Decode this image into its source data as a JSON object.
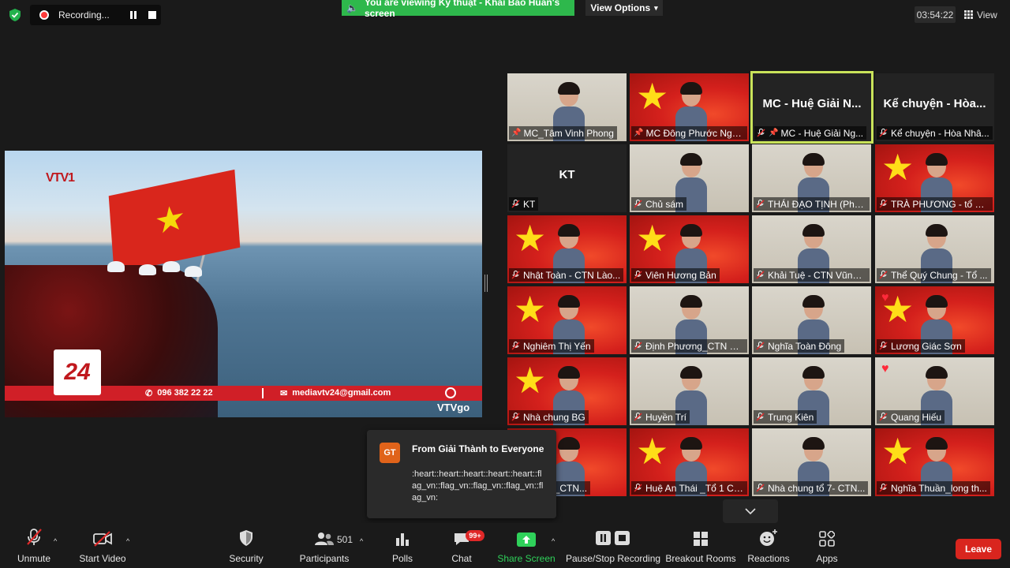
{
  "top": {
    "recording_label": "Recording...",
    "viewing_banner": "You are viewing Kỹ thuật - Khải Bảo Huấn's screen",
    "view_options": "View Options",
    "timer": "03:54:22",
    "view_label": "View"
  },
  "shared_screen": {
    "channel_logo": "VTV1",
    "badge": "24",
    "ticker_phone": "096 382 22 22",
    "ticker_email": "mediavtv24@gmail.com",
    "corner_logo": "VTVgo"
  },
  "participants": [
    {
      "name": "MC_Tâm Vinh Phong",
      "center_name": "",
      "muted": false,
      "pinned": true
    },
    {
      "name": "MC Đông Phước Nghĩa",
      "center_name": "",
      "muted": false,
      "pinned": true
    },
    {
      "name": "MC - Huệ Giải Ng...",
      "center_name": "MC - Huệ Giải N...",
      "muted": true,
      "pinned": true,
      "active_speaker": true
    },
    {
      "name": "Kể chuyện - Hòa Nhâ...",
      "center_name": "Kể chuyện - Hòa...",
      "muted": true,
      "pinned": false
    },
    {
      "name": "KT",
      "center_name": "KT",
      "muted": true,
      "pinned": false
    },
    {
      "name": "Chủ sám",
      "center_name": "",
      "muted": true,
      "pinned": false
    },
    {
      "name": "THÁI ĐẠO TỊNH (Phật...",
      "center_name": "",
      "muted": true,
      "pinned": false
    },
    {
      "name": "TRÀ PHƯƠNG - tổ 1 ...",
      "center_name": "",
      "muted": true,
      "pinned": false
    },
    {
      "name": "Nhật Toàn - CTN Lào...",
      "center_name": "",
      "muted": true,
      "pinned": false
    },
    {
      "name": "Viên Hương Bản",
      "center_name": "",
      "muted": true,
      "pinned": false
    },
    {
      "name": "Khải Tuệ - CTN Vũng ...",
      "center_name": "",
      "muted": true,
      "pinned": false
    },
    {
      "name": "Thể Quý Chung - Tổ ...",
      "center_name": "",
      "muted": true,
      "pinned": false
    },
    {
      "name": "Nghiêm Thị Yến",
      "center_name": "",
      "muted": true,
      "pinned": false
    },
    {
      "name": "Định Phương_CTN H...",
      "center_name": "",
      "muted": true,
      "pinned": false
    },
    {
      "name": "Nghĩa Toàn Đông",
      "center_name": "",
      "muted": true,
      "pinned": false
    },
    {
      "name": "Lương Giác Sơn",
      "center_name": "",
      "muted": true,
      "pinned": false
    },
    {
      "name": "Nhà chung BG",
      "center_name": "",
      "muted": true,
      "pinned": false
    },
    {
      "name": "Huyền Trí",
      "center_name": "",
      "muted": true,
      "pinned": false
    },
    {
      "name": "Trung Kiên",
      "center_name": "",
      "muted": true,
      "pinned": false
    },
    {
      "name": "Quang Hiếu",
      "center_name": "",
      "muted": true,
      "pinned": false
    },
    {
      "name": "...ng Niệm_CTN...",
      "center_name": "",
      "muted": false,
      "pinned": false
    },
    {
      "name": "Huệ An Thái _Tổ 1 CT...",
      "center_name": "",
      "muted": true,
      "pinned": false
    },
    {
      "name": "Nhà chung tổ 7- CTN...",
      "center_name": "",
      "muted": true,
      "pinned": false
    },
    {
      "name": "Nghĩa Thuần_long th...",
      "center_name": "",
      "muted": true,
      "pinned": false
    }
  ],
  "chat": {
    "avatar_initials": "GT",
    "from": "From Giải Thành to Everyone",
    "message": ":heart::heart::heart::heart::heart::flag_vn::flag_vn::flag_vn::flag_vn::flag_vn:"
  },
  "toolbar": {
    "unmute": "Unmute",
    "start_video": "Start Video",
    "security": "Security",
    "participants": "Participants",
    "participants_count": "501",
    "polls": "Polls",
    "chat": "Chat",
    "chat_badge": "99+",
    "share_screen": "Share Screen",
    "pause_stop_recording": "Pause/Stop Recording",
    "breakout_rooms": "Breakout Rooms",
    "reactions": "Reactions",
    "apps": "Apps",
    "leave": "Leave"
  },
  "colors": {
    "accent_green": "#2eb84c",
    "active_speaker_border": "#c9e35a",
    "leave_red": "#d9251e",
    "mute_red": "#e02828"
  }
}
